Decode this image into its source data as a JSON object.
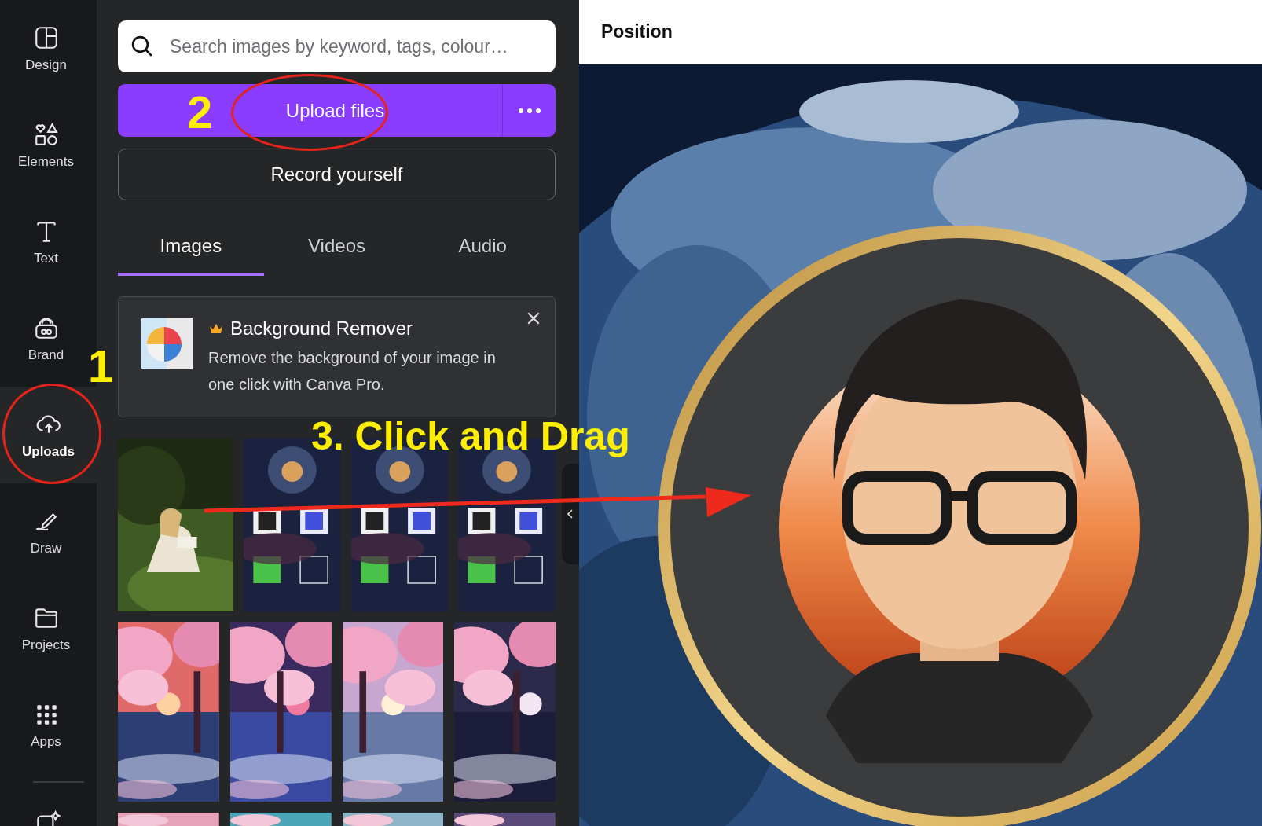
{
  "rail": {
    "items": [
      {
        "label": "Design",
        "selected": false
      },
      {
        "label": "Elements",
        "selected": false
      },
      {
        "label": "Text",
        "selected": false
      },
      {
        "label": "Brand",
        "selected": false
      },
      {
        "label": "Uploads",
        "selected": true
      },
      {
        "label": "Draw",
        "selected": false
      },
      {
        "label": "Projects",
        "selected": false
      },
      {
        "label": "Apps",
        "selected": false
      }
    ]
  },
  "panel": {
    "search": {
      "placeholder": "Search images by keyword, tags, colour…"
    },
    "upload_button": "Upload files",
    "record_button": "Record yourself",
    "tabs": [
      {
        "label": "Images",
        "selected": true
      },
      {
        "label": "Videos",
        "selected": false
      },
      {
        "label": "Audio",
        "selected": false
      }
    ],
    "promo": {
      "title": "Background Remover",
      "text": "Remove the background of your image in one click with Canva Pro."
    }
  },
  "canvas": {
    "title": "Position"
  },
  "annotations": [
    {
      "text": "1"
    },
    {
      "text": "2"
    },
    {
      "text": "3. Click and Drag"
    }
  ]
}
